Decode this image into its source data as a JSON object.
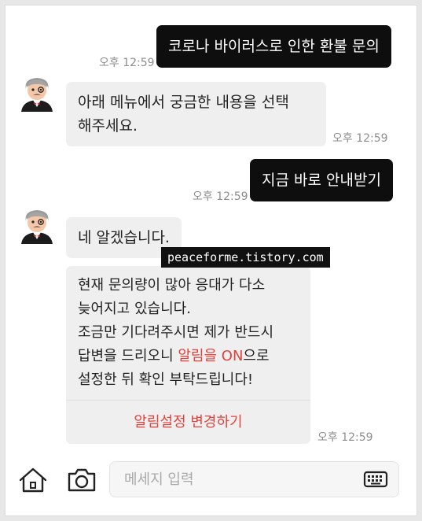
{
  "messages": {
    "out1": {
      "text": "코로나 바이러스로 인한 환불 문의",
      "time": "오후 12:59"
    },
    "in1": {
      "line1": "아래 메뉴에서 궁금한 내용을 선택",
      "line2": "해주세요.",
      "time": "오후 12:59"
    },
    "out2": {
      "text": "지금 바로 안내받기",
      "time": "오후 12:59"
    },
    "in2": {
      "text": "네 알겠습니다."
    },
    "card": {
      "line1": "현재 문의량이 많아 응대가 다소",
      "line2": "늦어지고 있습니다.",
      "line3": "조금만 기다려주시면 제가 반드시",
      "line4_a": "답변을 드리오니 ",
      "line4_highlight": "알림을 ON",
      "line4_b": "으로",
      "line5": "설정한 뒤 확인 부탁드립니다!",
      "button_label": "알림설정 변경하기",
      "time": "오후 12:59"
    }
  },
  "watermark": "peaceforme.tistory.com",
  "bottom_bar": {
    "home_icon": "home-icon",
    "camera_icon": "camera-icon",
    "keyboard_icon": "keyboard-icon",
    "input_placeholder": "메세지 입력"
  },
  "colors": {
    "accent_red": "#e2433d",
    "outgoing_bubble": "#0e0e0e",
    "incoming_bubble": "#efefef"
  }
}
